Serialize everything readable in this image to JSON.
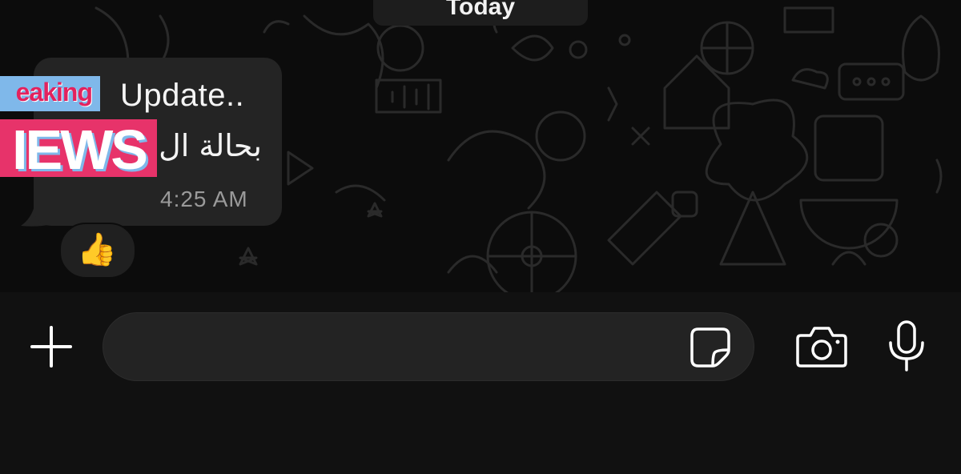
{
  "date_divider": "Today",
  "message": {
    "media_tag_top": "eaking",
    "media_tag_bottom": "IEWS",
    "title": "Update..",
    "body": "بحالة ال",
    "time": "4:25 AM",
    "reaction": "👍"
  },
  "composer": {
    "placeholder": "",
    "value": ""
  },
  "icons": {
    "plus": "plus-icon",
    "sticker": "sticker-icon",
    "camera": "camera-icon",
    "mic": "microphone-icon"
  },
  "colors": {
    "background": "#0c0c0c",
    "bubble": "#242424",
    "input_bar": "#111111",
    "news_pink": "#e7336a",
    "news_blue": "#7fb8ea"
  }
}
